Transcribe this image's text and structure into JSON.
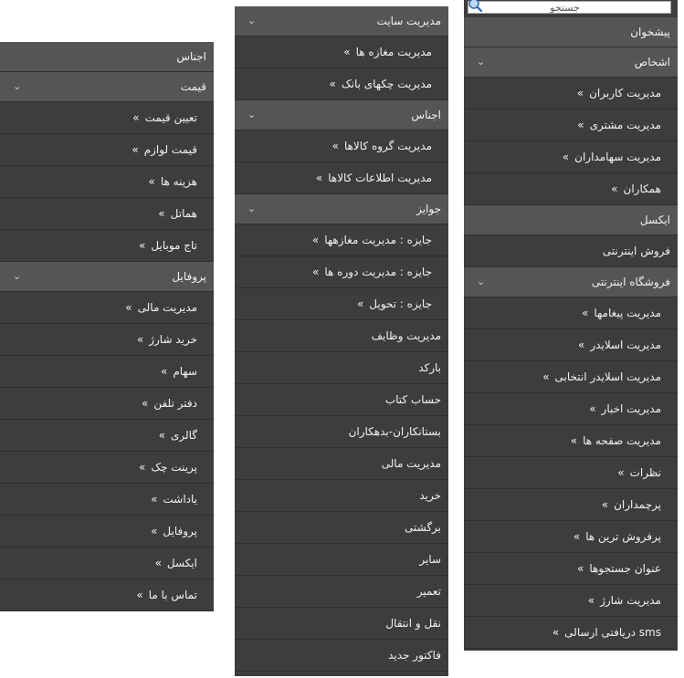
{
  "colors": {
    "panel": "#3d3d3d",
    "header": "#555555",
    "text": "#f2f2f2"
  },
  "bullet": "»",
  "right_menu": {
    "search": {
      "placeholder": "جستجو",
      "icon": "magnifier-icon"
    },
    "items": [
      {
        "kind": "header",
        "label": "پیشخوان"
      },
      {
        "kind": "header",
        "label": "اشخاص",
        "chevron": true
      },
      {
        "kind": "sub",
        "label": "مدیریت کاربران"
      },
      {
        "kind": "sub",
        "label": "مدیریت مشتری"
      },
      {
        "kind": "sub",
        "label": "مدیریت سهامداران"
      },
      {
        "kind": "sub",
        "label": "همکاران"
      },
      {
        "kind": "header",
        "label": "ایکسل"
      },
      {
        "kind": "plain",
        "label": "فروش اینترنتی"
      },
      {
        "kind": "header",
        "label": "فروشگاه اینترنتی",
        "chevron": true
      },
      {
        "kind": "sub",
        "label": "مدیریت پیغامها"
      },
      {
        "kind": "sub",
        "label": "مدیریت اسلایدر"
      },
      {
        "kind": "sub",
        "label": "مدیریت اسلایدر انتخابی"
      },
      {
        "kind": "sub",
        "label": "مدیریت اخبار"
      },
      {
        "kind": "sub",
        "label": "مدیریت صفحه ها"
      },
      {
        "kind": "sub",
        "label": "نظرات"
      },
      {
        "kind": "sub",
        "label": "پرچمداران"
      },
      {
        "kind": "sub",
        "label": "پرفروش ترین ها"
      },
      {
        "kind": "sub",
        "label": "عنوان جستجوها"
      },
      {
        "kind": "sub",
        "label": "مدیریت شارژ"
      },
      {
        "kind": "sub",
        "label": "sms دریافتی ارسالی"
      }
    ]
  },
  "middle_menu": {
    "items": [
      {
        "kind": "header",
        "label": "مدیریت سایت",
        "chevron": true
      },
      {
        "kind": "sub",
        "label": "مدیریت مغازه ها"
      },
      {
        "kind": "sub",
        "label": "مدیریت چکهای بانک"
      },
      {
        "kind": "header",
        "label": "اجناس",
        "chevron": true
      },
      {
        "kind": "sub",
        "label": "مدیریت گروه کالاها"
      },
      {
        "kind": "sub",
        "label": "مدیریت اطلاعات کالاها"
      },
      {
        "kind": "header",
        "label": "جوایز",
        "chevron": true
      },
      {
        "kind": "sub",
        "label": "جایزه : مدیریت مغازهها"
      },
      {
        "kind": "sub",
        "label": "جایزه : مدیریت دوره ها"
      },
      {
        "kind": "sub",
        "label": "جایزه : تحویل"
      },
      {
        "kind": "plain",
        "label": "مدیریت وظایف"
      },
      {
        "kind": "plain",
        "label": "بارکد"
      },
      {
        "kind": "plain",
        "label": "حساب کتاب"
      },
      {
        "kind": "plain",
        "label": "بستانکاران-بدهکاران"
      },
      {
        "kind": "plain",
        "label": "مدیریت مالی"
      },
      {
        "kind": "plain",
        "label": "خرید"
      },
      {
        "kind": "plain",
        "label": "برگشتی"
      },
      {
        "kind": "plain",
        "label": "سایر"
      },
      {
        "kind": "plain",
        "label": "تعمیر"
      },
      {
        "kind": "plain",
        "label": "نقل و انتقال"
      },
      {
        "kind": "plain",
        "label": "فاکتور جدید"
      }
    ]
  },
  "left_menu": {
    "items": [
      {
        "kind": "plain-h",
        "label": "اجناس"
      },
      {
        "kind": "header",
        "label": "قیمت",
        "chevron": true
      },
      {
        "kind": "sub",
        "label": "تعیین قیمت"
      },
      {
        "kind": "sub",
        "label": "قیمت لوازم"
      },
      {
        "kind": "sub",
        "label": "هزینه ها"
      },
      {
        "kind": "sub",
        "label": "هماتل"
      },
      {
        "kind": "sub",
        "label": "تاج موبایل"
      },
      {
        "kind": "header",
        "label": "پروفایل",
        "chevron": true
      },
      {
        "kind": "sub",
        "label": "مدیریت مالی"
      },
      {
        "kind": "sub",
        "label": "خرید شارژ"
      },
      {
        "kind": "sub",
        "label": "سهام"
      },
      {
        "kind": "sub",
        "label": "دفتر تلفن"
      },
      {
        "kind": "sub",
        "label": "گالری"
      },
      {
        "kind": "sub",
        "label": "پرینت چک"
      },
      {
        "kind": "sub",
        "label": "یاداشت"
      },
      {
        "kind": "sub",
        "label": "پروفایل"
      },
      {
        "kind": "sub",
        "label": "ایکسل"
      },
      {
        "kind": "sub",
        "label": "تماس با ما"
      }
    ]
  }
}
